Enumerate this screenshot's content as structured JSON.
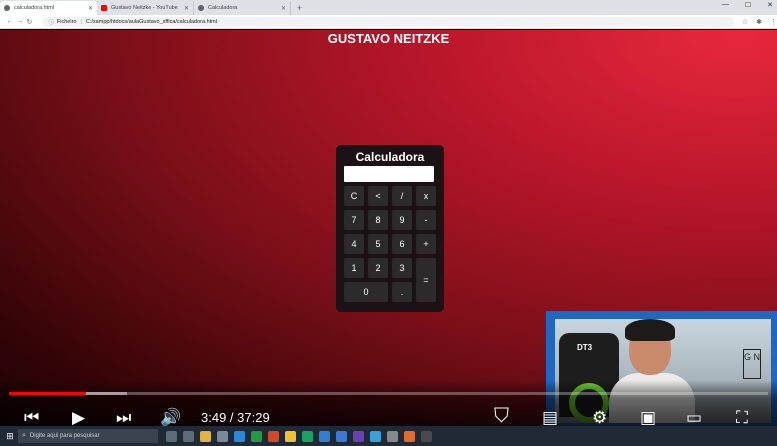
{
  "browser": {
    "tabs": [
      {
        "title": "calculadora.html",
        "active": true,
        "favicon_color": "#5f6368"
      },
      {
        "title": "Gustavo Neitzke - YouTube",
        "active": false,
        "favicon_color": "#ff0000"
      },
      {
        "title": "Calculadora",
        "active": false,
        "favicon_color": "#5f6368"
      }
    ],
    "new_tab_label": "+",
    "address": {
      "scheme_label": "Ficheiro",
      "url": "C:/xampp/htdocs/aulaGustavo_sffica/calculadora.html"
    }
  },
  "page": {
    "heading": "GUSTAVO NEITZKE",
    "calculator": {
      "title": "Calculadora",
      "display_value": "",
      "keys": [
        "C",
        "<",
        "/",
        "x",
        "7",
        "8",
        "9",
        "-",
        "4",
        "5",
        "6",
        "+",
        "1",
        "2",
        "3",
        "=",
        "0",
        "."
      ]
    }
  },
  "player": {
    "current_time": "3:49",
    "duration": "37:29",
    "time_display": "3:49 / 37:29",
    "progress_fraction": 0.102,
    "accent_color": "#ff0000"
  },
  "webcam_overlay": {
    "chair_brand": "DT3",
    "logo_text": "G N"
  },
  "taskbar": {
    "search_placeholder": "Digite aqui para pesquisar"
  }
}
